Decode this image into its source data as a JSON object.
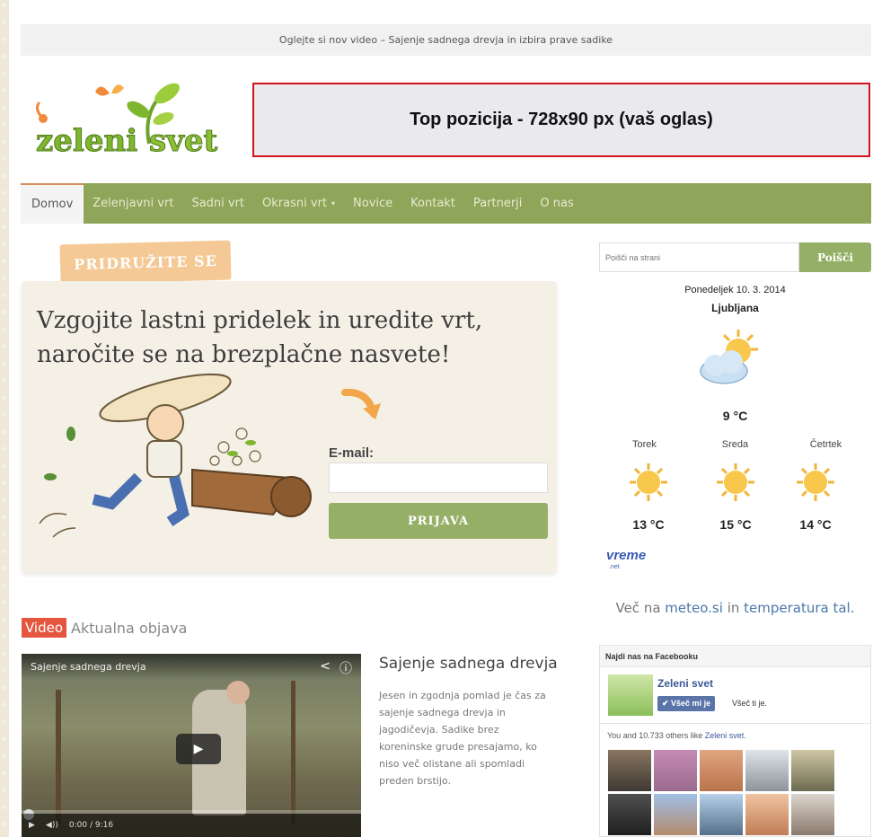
{
  "announce": {
    "text": "Oglejte si nov video – Sajenje sadnega drevja in izbira prave sadike"
  },
  "ad": {
    "label": "Top pozicija - 728x90 px (vaš oglas)"
  },
  "nav": {
    "items": [
      {
        "label": "Domov",
        "active": true
      },
      {
        "label": "Zelenjavni vrt"
      },
      {
        "label": "Sadni vrt"
      },
      {
        "label": "Okrasni vrt",
        "dropdown": true,
        "caret": "▾"
      },
      {
        "label": "Novice"
      },
      {
        "label": "Kontakt"
      },
      {
        "label": "Partnerji"
      },
      {
        "label": "O nas"
      }
    ]
  },
  "signup": {
    "ribbon": "PRIDRUŽITE SE",
    "title": "Vzgojite lastni pridelek in uredite vrt, naročite se na brezplačne nasvete!",
    "email_label": "E-mail:",
    "email_value": "",
    "button": "PRIJAVA"
  },
  "video_section": {
    "tag": "Video",
    "subtitle": "Aktualna objava",
    "video_title": "Sajenje sadnega drevja",
    "time": "0:00 / 9:16",
    "article_title": "Sajenje sadnega drevja",
    "article_text": "Jesen in zgodnja pomlad je čas za sajenje sadnega drevja in jagodičevja. Sadike brez koreninske grude presajamo, ko niso več olistane ali spomladi preden brstijo."
  },
  "search": {
    "placeholder": "Poišči na strani",
    "button": "Poišči"
  },
  "weather": {
    "date": "Ponedeljek 10. 3. 2014",
    "city": "Ljubljana",
    "today_temp": "9 °C",
    "days": [
      {
        "name": "Torek",
        "temp": "13 °C"
      },
      {
        "name": "Sreda",
        "temp": "15 °C"
      },
      {
        "name": "Četrtek",
        "temp": "14 °C"
      }
    ],
    "brand": "vreme",
    "brand_sub": ".net",
    "more_prefix": "Več na ",
    "more_link1": "meteo.si",
    "more_mid": " in ",
    "more_link2": "temperatura tal."
  },
  "facebook": {
    "header": "Najdi nas na Facebooku",
    "page_name": "Zeleni svet",
    "like_button": "✔ Všeč mi je",
    "like_text": "Všeč ti je.",
    "others_prefix": "You and 10.733 others like ",
    "others_link": "Zeleni svet."
  },
  "colors": {
    "nav": "#8fa55a",
    "button": "#95b066",
    "tag": "#e5563f",
    "ad_border": "#d4141f"
  }
}
